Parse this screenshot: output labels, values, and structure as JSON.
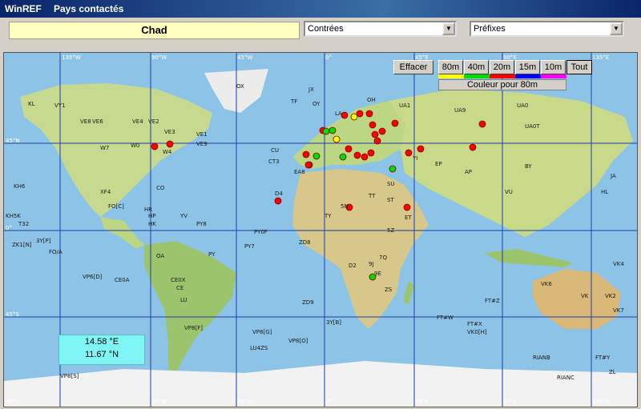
{
  "window": {
    "app_title": "WinREF",
    "window_title": "Pays contactés"
  },
  "selection": {
    "country": "Chad"
  },
  "combos": {
    "zones": "Contrées",
    "prefixes": "Préfixes"
  },
  "buttons": {
    "clear": "Effacer",
    "all": "Tout"
  },
  "bands": [
    {
      "label": "80m",
      "color": "#ffff00"
    },
    {
      "label": "40m",
      "color": "#00dd00"
    },
    {
      "label": "20m",
      "color": "#ff0000"
    },
    {
      "label": "15m",
      "color": "#0000ff"
    },
    {
      "label": "10m",
      "color": "#ff00ff"
    }
  ],
  "color_label": "Couleur pour 80m",
  "coordinates": {
    "lon": "14.58 °E",
    "lat": "11.67 °N"
  },
  "grid": {
    "top_longitudes": [
      "135°W",
      "90°W",
      "45°W",
      "0°",
      "45°E",
      "90°E",
      "135°E"
    ],
    "bottom_longitudes": [
      "90°W",
      "45°W",
      "0°",
      "45°E",
      "90°E",
      "135°E"
    ],
    "bottom_left": "30°S",
    "latitudes": [
      "45°N",
      "0°",
      "45°S"
    ]
  },
  "prefix_labels": [
    "KL",
    "VY1",
    "VE8",
    "VE2",
    "VE3",
    "VE6",
    "VE4",
    "W7",
    "W0",
    "W4",
    "VE1",
    "VE9",
    "KH6",
    "XF4",
    "KH5K",
    "T32",
    "FO[C]",
    "CO",
    "HR",
    "HP",
    "HK",
    "YV",
    "PY8",
    "PY0F",
    "PY7",
    "OA",
    "PY",
    "CE",
    "LU",
    "VP8[F]",
    "VP8[G]",
    "ZL",
    "VK",
    "VK6",
    "VK4",
    "VK2",
    "VK7",
    "OX",
    "TF",
    "JX",
    "OY",
    "LA",
    "OH",
    "UA1",
    "UA9",
    "UA0",
    "UA0T",
    "BY",
    "JA",
    "HL",
    "VU",
    "AP",
    "EP",
    "YI",
    "SU",
    "ST",
    "ET",
    "5Z",
    "7Q",
    "ZS",
    "D2",
    "9J",
    "TT",
    "5N",
    "TY",
    "D4",
    "CU",
    "EA8",
    "CT3",
    "3Y[B]",
    "FT#W",
    "FT#X",
    "VK0[H]",
    "RIANC",
    "RIANB",
    "FT#Y",
    "FT#Z",
    "ZD8",
    "ZD9",
    "9E",
    "CE0X",
    "CE0A",
    "VP6[D]",
    "FO/A",
    "ZK1[N]",
    "3Y[P]",
    "VP8[S]",
    "VP8[O]",
    "LU4ZS"
  ]
}
